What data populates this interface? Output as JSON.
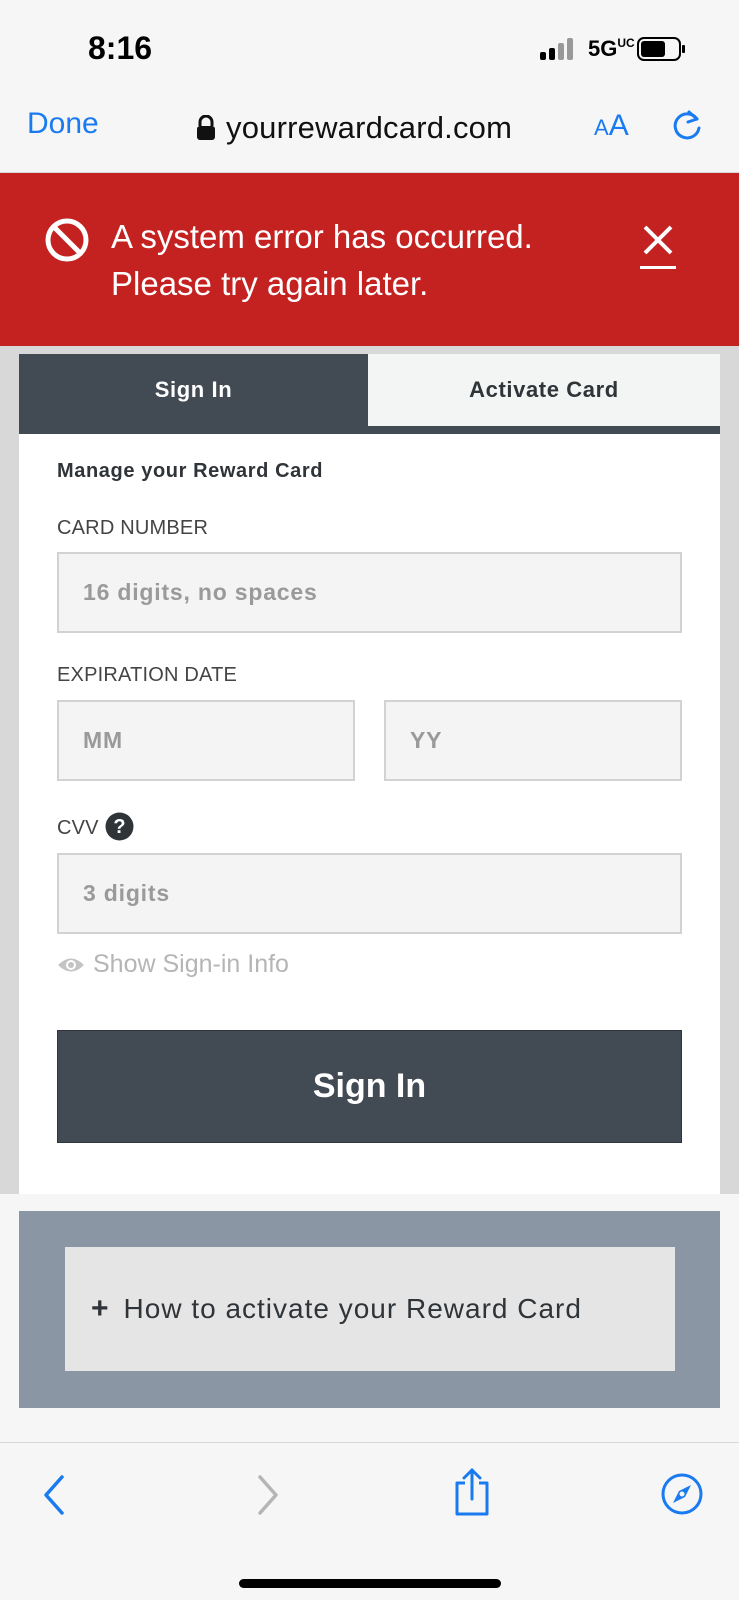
{
  "status_bar": {
    "time": "8:16",
    "network": "5G",
    "network_sup": "UC"
  },
  "browser": {
    "done_label": "Done",
    "url": "yourrewardcard.com",
    "text_size_small": "A",
    "text_size_large": "A"
  },
  "error_banner": {
    "line1": "A system error has occurred.",
    "line2": "Please try again later."
  },
  "tabs": [
    {
      "label": "Sign In",
      "active": true
    },
    {
      "label": "Activate Card",
      "active": false
    }
  ],
  "form": {
    "title": "Manage your Reward Card",
    "card_number": {
      "label": "CARD NUMBER",
      "placeholder": "16 digits, no spaces"
    },
    "expiration": {
      "label": "EXPIRATION DATE",
      "month_placeholder": "MM",
      "year_placeholder": "YY"
    },
    "cvv": {
      "label": "CVV",
      "placeholder": "3 digits"
    },
    "show_info": "Show Sign-in Info",
    "submit": "Sign In"
  },
  "accordion": {
    "plus": "+",
    "label": "How to activate your Reward Card"
  },
  "colors": {
    "accent": "#1a7bf0",
    "error": "#c42121",
    "dark": "#424a53",
    "panel": "#8a96a3"
  },
  "icons": [
    "signal-icon",
    "battery-icon",
    "lock-icon",
    "reload-icon",
    "error-prohibit-icon",
    "close-icon",
    "help-icon",
    "eye-icon",
    "back-icon",
    "forward-icon",
    "share-icon",
    "compass-icon"
  ]
}
